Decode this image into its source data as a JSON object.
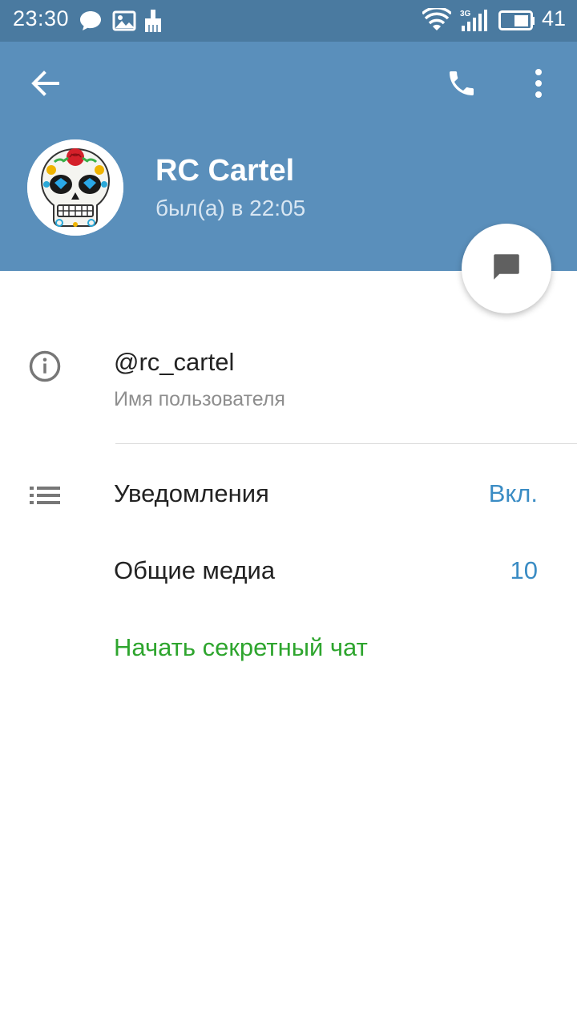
{
  "status_bar": {
    "time": "23:30",
    "notification_icons": [
      "chat-bubble-icon",
      "image-icon",
      "broom-icon"
    ],
    "network_label": "3G",
    "battery_level": "41"
  },
  "header": {
    "back_icon": "back-arrow-icon",
    "call_icon": "phone-icon",
    "menu_icon": "more-vert-icon",
    "profile": {
      "name": "RC Cartel",
      "last_seen": "был(а) в 22:05",
      "avatar": "sugar-skull-avatar"
    },
    "fab_icon": "message-icon"
  },
  "info": {
    "username": "@rc_cartel",
    "username_caption": "Имя пользователя"
  },
  "rows": {
    "notifications": {
      "label": "Уведомления",
      "value": "Вкл."
    },
    "shared_media": {
      "label": "Общие медиа",
      "value": "10"
    },
    "secret_chat": {
      "label": "Начать секретный чат"
    }
  },
  "colors": {
    "status_bar": "#4a7aa0",
    "header": "#5a8fbb",
    "accent_blue": "#3a8cc4",
    "accent_green": "#2ea52e"
  }
}
